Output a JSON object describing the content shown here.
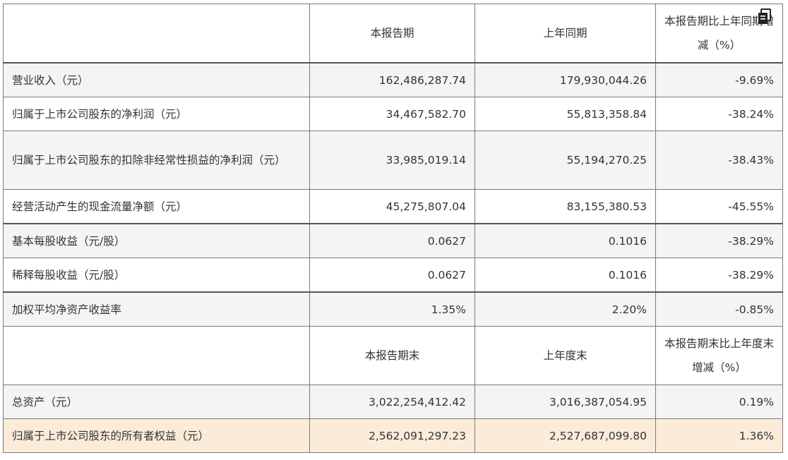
{
  "table": {
    "header1": {
      "col1": "",
      "col2": "本报告期",
      "col3": "上年同期",
      "col4": "本报告期比上年同期增减（%）"
    },
    "rows1": [
      {
        "label": "营业收入（元）",
        "current": "162,486,287.74",
        "prior": "179,930,044.26",
        "change": "-9.69%"
      },
      {
        "label": "归属于上市公司股东的净利润（元）",
        "current": "34,467,582.70",
        "prior": "55,813,358.84",
        "change": "-38.24%"
      },
      {
        "label": "归属于上市公司股东的扣除非经常性损益的净利润（元）",
        "current": "33,985,019.14",
        "prior": "55,194,270.25",
        "change": "-38.43%"
      },
      {
        "label": "经营活动产生的现金流量净额（元）",
        "current": "45,275,807.04",
        "prior": "83,155,380.53",
        "change": "-45.55%"
      },
      {
        "label": "基本每股收益（元/股）",
        "current": "0.0627",
        "prior": "0.1016",
        "change": "-38.29%"
      },
      {
        "label": "稀释每股收益（元/股）",
        "current": "0.0627",
        "prior": "0.1016",
        "change": "-38.29%"
      },
      {
        "label": "加权平均净资产收益率",
        "current": "1.35%",
        "prior": "2.20%",
        "change": "-0.85%"
      }
    ],
    "header2": {
      "col1": "",
      "col2": "本报告期末",
      "col3": "上年度末",
      "col4": "本报告期末比上年度末增减（%）"
    },
    "rows2": [
      {
        "label": "总资产（元）",
        "current": "3,022,254,412.42",
        "prior": "3,016,387,054.95",
        "change": "0.19%"
      },
      {
        "label": "归属于上市公司股东的所有者权益（元）",
        "current": "2,562,091,297.23",
        "prior": "2,527,687,099.80",
        "change": "1.36%"
      }
    ]
  },
  "icons": {
    "copy": "copy-icon"
  }
}
